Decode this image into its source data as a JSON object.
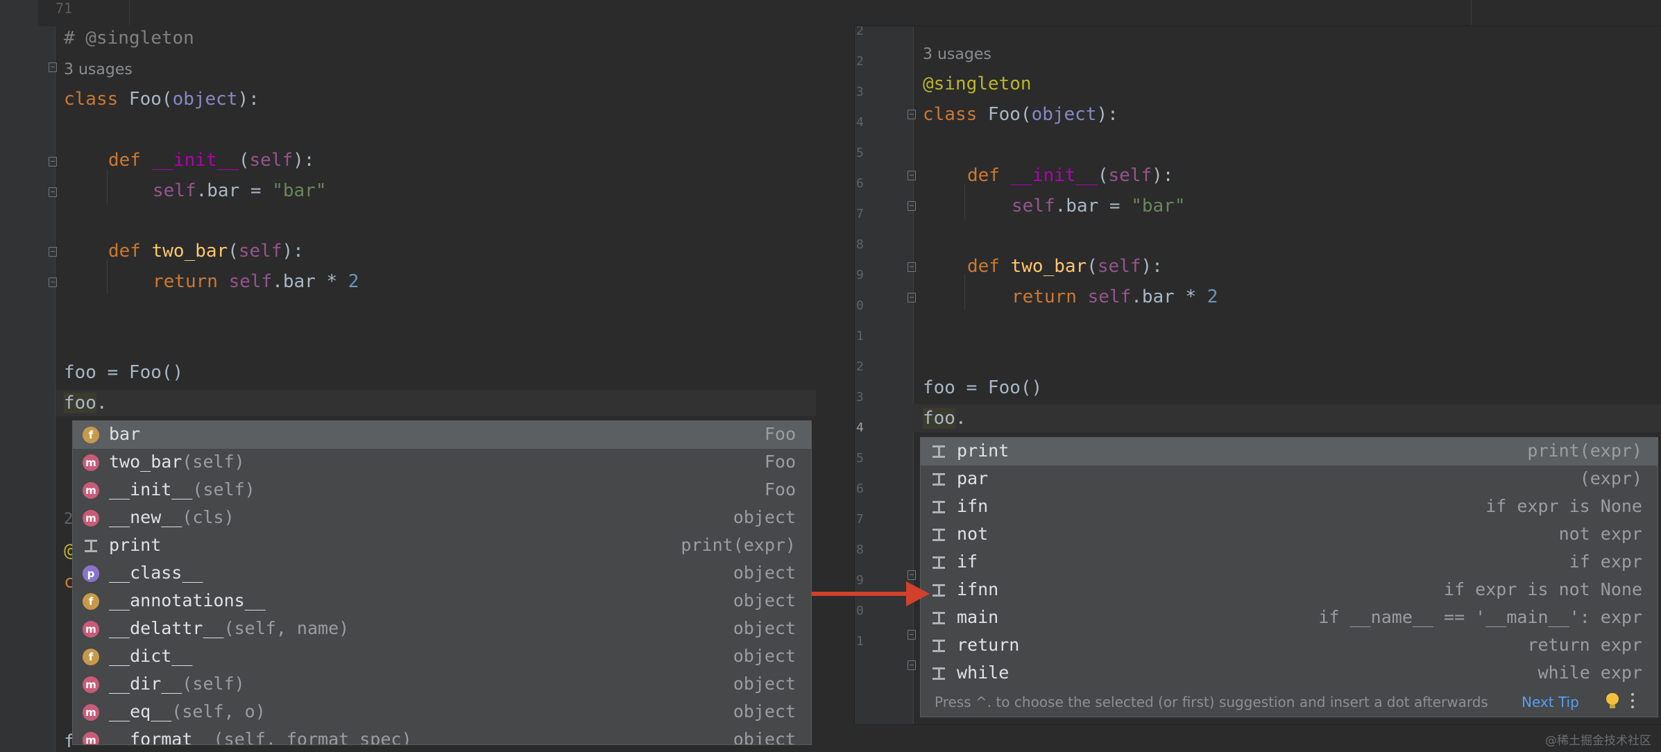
{
  "background": {
    "line_number": "71"
  },
  "left_editor": {
    "code": {
      "comment": "# @singleton",
      "usages": "3 usages",
      "l_class_kw": "class",
      "l_class_name": " Foo(",
      "l_class_base": "object",
      "l_class_end": "):",
      "l_def1_kw": "def",
      "l_def1_name": "__init__",
      "l_def1_open": "(",
      "l_def1_self": "self",
      "l_def1_end": "):",
      "l_assign_self": "self",
      "l_assign_mid": ".bar = ",
      "l_assign_str": "\"bar\"",
      "l_def2_kw": "def",
      "l_def2_name": "two_bar",
      "l_def2_open": "(",
      "l_def2_self": "self",
      "l_def2_end": "):",
      "l_ret_kw": "return",
      "l_ret_self": "self",
      "l_ret_mid": ".bar * ",
      "l_ret_num": "2",
      "l_foo_assign": "foo = Foo()",
      "l_foo": "foo",
      "l_dot": "."
    },
    "peek": {
      "line_no": "2",
      "deco": "@",
      "kw": "c",
      "last": "f"
    },
    "completion": [
      {
        "icon": "f",
        "icon_name": "field-icon",
        "name": "bar",
        "args": "",
        "type": "Foo"
      },
      {
        "icon": "m",
        "icon_name": "method-icon",
        "name": "two_bar",
        "args": "(self)",
        "type": "Foo"
      },
      {
        "icon": "m",
        "icon_name": "method-icon",
        "name": "__init__",
        "args": "(self)",
        "type": "Foo"
      },
      {
        "icon": "m",
        "icon_name": "method-icon",
        "name": "__new__",
        "args": "(cls)",
        "type": "object"
      },
      {
        "icon": "t",
        "icon_name": "postfix-template-icon",
        "name": "print",
        "args": "",
        "type": "print(expr)"
      },
      {
        "icon": "p",
        "icon_name": "property-icon",
        "name": "__class__",
        "args": "",
        "type": "object"
      },
      {
        "icon": "f",
        "icon_name": "field-icon",
        "name": "__annotations__",
        "args": "",
        "type": "object"
      },
      {
        "icon": "m",
        "icon_name": "method-icon",
        "name": "__delattr__",
        "args": "(self, name)",
        "type": "object"
      },
      {
        "icon": "f",
        "icon_name": "field-icon",
        "name": "__dict__",
        "args": "",
        "type": "object"
      },
      {
        "icon": "m",
        "icon_name": "method-icon",
        "name": "__dir__",
        "args": "(self)",
        "type": "object"
      },
      {
        "icon": "m",
        "icon_name": "method-icon",
        "name": "__eq__",
        "args": "(self, o)",
        "type": "object"
      },
      {
        "icon": "m",
        "icon_name": "method-icon",
        "name": "__format__",
        "args": "(self, format_spec)",
        "type": "object"
      }
    ]
  },
  "right_editor": {
    "line_numbers": [
      "2",
      "2",
      "3",
      "4",
      "5",
      "6",
      "7",
      "8",
      "9",
      "0",
      "1",
      "2",
      "3",
      "4",
      "5",
      "6",
      "7",
      "8",
      "9",
      "0",
      "1"
    ],
    "code": {
      "usages": "3 usages",
      "decorator": "@singleton",
      "l_class_kw": "class",
      "l_class_name": " Foo(",
      "l_class_base": "object",
      "l_class_end": "):",
      "l_def1_kw": "def",
      "l_def1_name": "__init__",
      "l_def1_open": "(",
      "l_def1_self": "self",
      "l_def1_end": "):",
      "l_assign_self": "self",
      "l_assign_mid": ".bar = ",
      "l_assign_str": "\"bar\"",
      "l_def2_kw": "def",
      "l_def2_name": "two_bar",
      "l_def2_open": "(",
      "l_def2_self": "self",
      "l_def2_end": "):",
      "l_ret_kw": "return",
      "l_ret_self": "self",
      "l_ret_mid": ".bar * ",
      "l_ret_num": "2",
      "l_foo_assign": "foo = Foo()",
      "l_foo": "foo",
      "l_dot": "."
    },
    "completion": [
      {
        "name": "print",
        "type": "print(expr)"
      },
      {
        "name": "par",
        "type": "(expr)"
      },
      {
        "name": "ifn",
        "type": "if expr is None"
      },
      {
        "name": "not",
        "type": "not expr"
      },
      {
        "name": "if",
        "type": "if expr"
      },
      {
        "name": "ifnn",
        "type": "if expr is not None"
      },
      {
        "name": "main",
        "type": "if __name__ == '__main__': expr"
      },
      {
        "name": "return",
        "type": "return expr"
      },
      {
        "name": "while",
        "type": "while expr"
      }
    ],
    "footer": {
      "hint": "Press ^. to choose the selected (or first) suggestion and insert a dot afterwards",
      "next_tip": "Next Tip"
    }
  },
  "watermark": "@稀土掘金技术社区",
  "colors": {
    "arrow": "#d2412c",
    "selection": "#5c5f62",
    "popup": "#46484a",
    "link": "#589df6"
  }
}
